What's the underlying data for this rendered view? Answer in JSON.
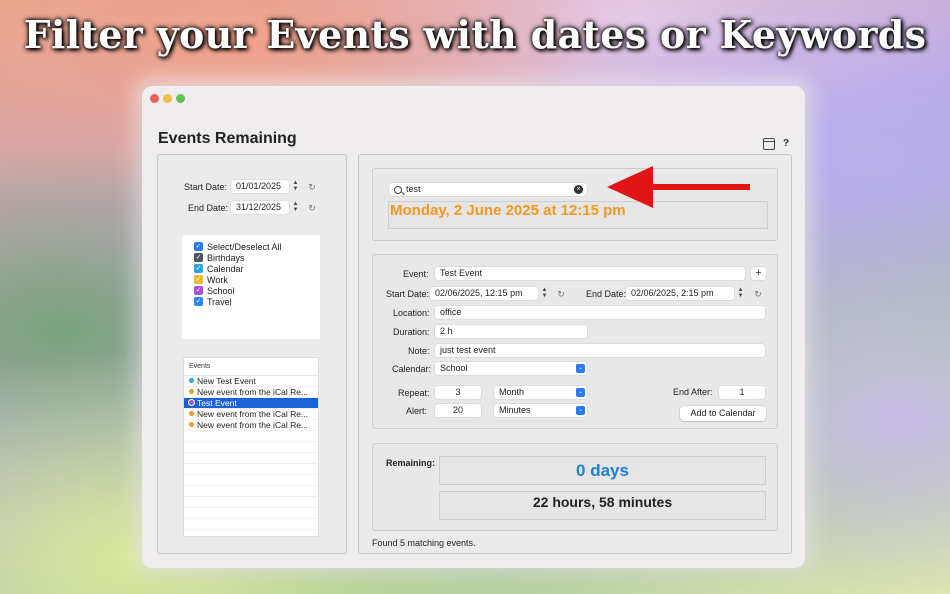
{
  "headline": "Filter your Events with dates or Keywords",
  "window": {
    "title": "Events Remaining",
    "toolbar": {
      "sidebar_icon": "sidebar-icon",
      "help_label": "?"
    }
  },
  "filters": {
    "start_date_label": "Start Date:",
    "start_date_value": "01/01/2025",
    "end_date_label": "End Date:",
    "end_date_value": "31/12/2025"
  },
  "calendars": [
    {
      "label": "Select/Deselect All",
      "color": "#2a7bf2"
    },
    {
      "label": "Birthdays",
      "color": "#4b5560"
    },
    {
      "label": "Calendar",
      "color": "#2aa6e3"
    },
    {
      "label": "Work",
      "color": "#f2b830"
    },
    {
      "label": "School",
      "color": "#b04fd4"
    },
    {
      "label": "Travel",
      "color": "#2a86f2"
    }
  ],
  "events": {
    "header": "Events",
    "rows": [
      {
        "label": "New Test Event",
        "color": "#2aa6e3",
        "selected": false
      },
      {
        "label": "New event from the iCal Re...",
        "color": "#f29a22",
        "selected": false
      },
      {
        "label": "Test Event",
        "color": "#b04fd4",
        "selected": true
      },
      {
        "label": "New event from the iCal Re...",
        "color": "#f29a22",
        "selected": false
      },
      {
        "label": "New event from the iCal Re...",
        "color": "#f29a22",
        "selected": false
      }
    ]
  },
  "search": {
    "value": "test",
    "current_date": "Monday, 2 June 2025 at 12:15 pm"
  },
  "detail": {
    "event_label": "Event:",
    "event_value": "Test Event",
    "start_date_label": "Start Date:",
    "start_date_value": "02/06/2025, 12:15 pm",
    "end_date_label": "End Date:",
    "end_date_value": "02/06/2025,  2:15 pm",
    "location_label": "Location:",
    "location_value": "office",
    "duration_label": "Duration:",
    "duration_value": "2 h",
    "note_label": "Note:",
    "note_value": "just test event",
    "calendar_label": "Calendar:",
    "calendar_value": "School",
    "repeat_label": "Repeat:",
    "repeat_count": "3",
    "repeat_unit": "Month",
    "alert_label": "Alert:",
    "alert_count": "20",
    "alert_unit": "Minutes",
    "end_after_label": "End After:",
    "end_after_value": "1",
    "add_button": "Add to Calendar"
  },
  "remaining": {
    "label": "Remaining:",
    "days": "0 days",
    "hours": "22 hours, 58 minutes",
    "days_color": "#1f7fd9"
  },
  "status": "Found 5 matching events.",
  "arrow_color": "#e01515"
}
